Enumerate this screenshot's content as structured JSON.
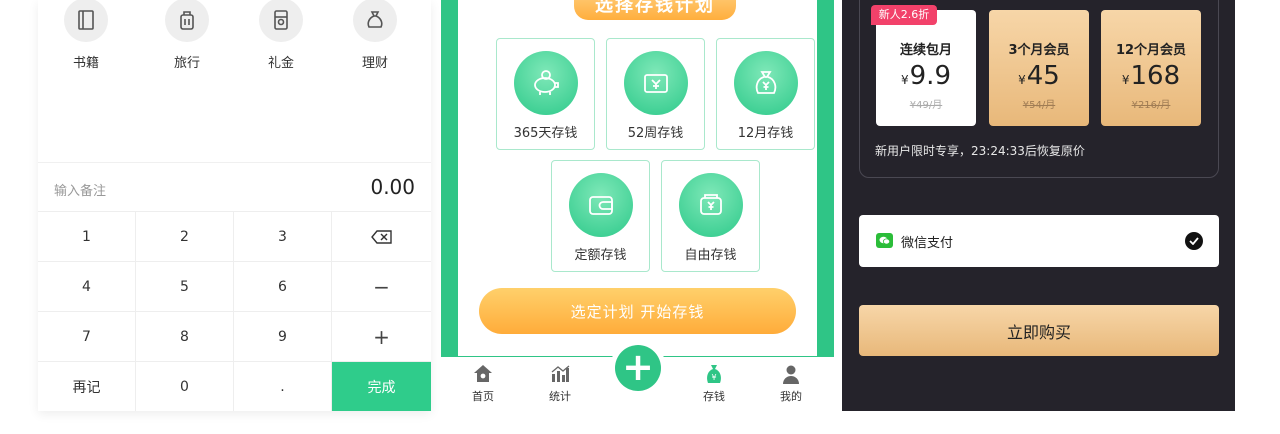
{
  "calculator": {
    "categories": [
      {
        "label": "书籍",
        "icon": "book-icon"
      },
      {
        "label": "旅行",
        "icon": "luggage-icon"
      },
      {
        "label": "礼金",
        "icon": "gift-money-icon"
      },
      {
        "label": "理财",
        "icon": "money-bag-icon"
      }
    ],
    "memo_placeholder": "输入备注",
    "amount": "0.00",
    "keys": {
      "k1": "1",
      "k2": "2",
      "k3": "3",
      "k4": "4",
      "k5": "5",
      "k6": "6",
      "minus": "−",
      "k7": "7",
      "k8": "8",
      "k9": "9",
      "plus": "+",
      "again": "再记",
      "k0": "0",
      "dot": ".",
      "done": "完成"
    }
  },
  "savings": {
    "banner": "选择存钱计划",
    "plans": [
      {
        "label": "365天存钱",
        "icon": "piggy-bank-icon"
      },
      {
        "label": "52周存钱",
        "icon": "yen-wallet-icon"
      },
      {
        "label": "12月存钱",
        "icon": "yen-bag-icon"
      },
      {
        "label": "定额存钱",
        "icon": "wallet-icon"
      },
      {
        "label": "自由存钱",
        "icon": "yen-purse-icon"
      }
    ],
    "start_button": "选定计划 开始存钱",
    "tabs": {
      "home": "首页",
      "stats": "统计",
      "save": "存钱",
      "mine": "我的"
    }
  },
  "membership": {
    "badge": "新人2.6折",
    "plans": [
      {
        "name": "连续包月",
        "currency": "¥",
        "price": "9.9",
        "original": "¥49/月"
      },
      {
        "name": "3个月会员",
        "currency": "¥",
        "price": "45",
        "original": "¥54/月"
      },
      {
        "name": "12个月会员",
        "currency": "¥",
        "price": "168",
        "original": "¥216/月"
      }
    ],
    "promo": "新用户限时专享，23:24:33后恢复原价",
    "payment": "微信支付",
    "buy_button": "立即购买"
  },
  "colors": {
    "green": "#2fc586",
    "orange": "#ffac3a",
    "gold": "#e8b87a",
    "dark": "#25232b",
    "badge_red": "#f2416a"
  }
}
